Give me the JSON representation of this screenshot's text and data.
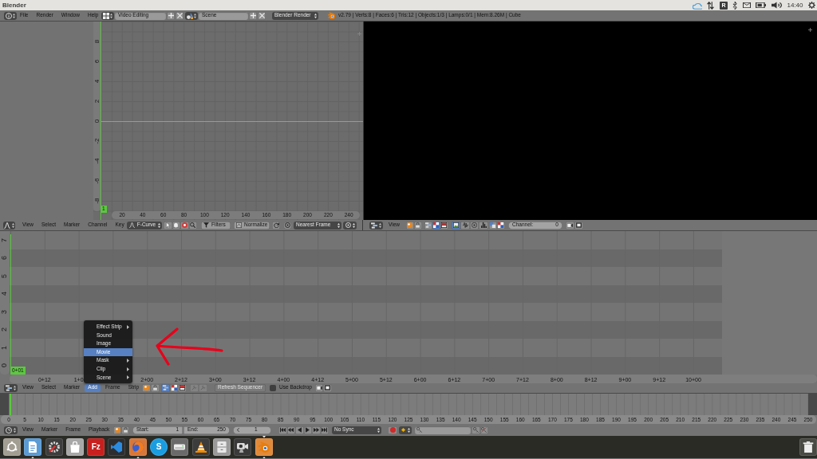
{
  "os_bar": {
    "title": "Blender",
    "tray_badge": "R",
    "clock": "14:40"
  },
  "info_header": {
    "menus": [
      "File",
      "Render",
      "Window",
      "Help"
    ],
    "screen_layout": "Video Editing",
    "scene": "Scene",
    "render_engine": "Blender Render",
    "stats": "v2.79 | Verts:8 | Faces:6 | Tris:12 | Objects:1/3 | Lamps:0/1 | Mem:8.26M | Cube"
  },
  "graph_editor": {
    "current_frame": "1",
    "value_ruler": [
      "8",
      "6",
      "4",
      "2",
      "0",
      "-2",
      "-4",
      "-6",
      "-8"
    ],
    "frame_ruler": [
      "20",
      "40",
      "60",
      "80",
      "100",
      "120",
      "140",
      "160",
      "180",
      "200",
      "220",
      "240"
    ],
    "header": {
      "menus": [
        "View",
        "Select",
        "Marker",
        "Channel",
        "Key"
      ],
      "mode": "F-Curve",
      "toggles": [
        {
          "kind": "pointer",
          "pressed": false
        },
        {
          "kind": "ghost",
          "pressed": false
        },
        {
          "kind": "alert",
          "pressed": false
        },
        {
          "kind": "search",
          "pressed": false
        }
      ],
      "filters": "Filters",
      "normalize": {
        "label": "Normalize",
        "pressed": false
      },
      "auto_snap": "Nearest Frame"
    }
  },
  "preview": {
    "header": {
      "menus": [
        "View"
      ],
      "view_types": [
        {
          "kind": "strips",
          "selected": false
        },
        {
          "kind": "checker",
          "selected": true
        },
        {
          "kind": "split",
          "selected": false
        }
      ],
      "display_modes": [
        {
          "kind": "image",
          "selected": true
        },
        {
          "kind": "wave",
          "selected": false
        },
        {
          "kind": "scope",
          "selected": false
        },
        {
          "kind": "histogram",
          "selected": false
        }
      ],
      "channel_label": "Channel:",
      "channel": "0"
    }
  },
  "sequencer": {
    "channels": [
      "7",
      "6",
      "5",
      "4",
      "3",
      "2",
      "1",
      "0"
    ],
    "current_frame": "0+01",
    "time_ruler": {
      "left": [
        "0+12",
        "1+0"
      ],
      "right": [
        "2+00",
        "2+12",
        "3+00",
        "3+12",
        "4+00",
        "4+12",
        "5+00",
        "5+12",
        "6+00",
        "6+12",
        "7+00",
        "7+12",
        "8+00",
        "8+12",
        "9+00",
        "9+12",
        "10+00"
      ]
    },
    "header": {
      "menus": [
        {
          "label": "View",
          "selected": false
        },
        {
          "label": "Select",
          "selected": false
        },
        {
          "label": "Marker",
          "selected": false
        },
        {
          "label": "Add",
          "selected": true
        },
        {
          "label": "Frame",
          "selected": false
        },
        {
          "label": "Strip",
          "selected": false
        }
      ],
      "view_types": [
        {
          "kind": "strips",
          "selected": true
        },
        {
          "kind": "checker",
          "selected": false
        },
        {
          "kind": "split",
          "selected": false
        }
      ],
      "refresh": {
        "label": "Refresh Sequencer",
        "disabled": true
      },
      "use_backdrop": {
        "label": "Use Backdrop",
        "checked": false
      }
    }
  },
  "add_menu": {
    "items": [
      {
        "label": "Effect Strip",
        "submenu": true,
        "selected": false
      },
      {
        "label": "Sound",
        "submenu": false,
        "selected": false
      },
      {
        "label": "Image",
        "submenu": false,
        "selected": false
      },
      {
        "label": "Movie",
        "submenu": false,
        "selected": true
      },
      {
        "label": "Mask",
        "submenu": true,
        "selected": false
      },
      {
        "label": "Clip",
        "submenu": true,
        "selected": false
      },
      {
        "label": "Scene",
        "submenu": true,
        "selected": false
      }
    ]
  },
  "timeline": {
    "frame_ruler": [
      "0",
      "5",
      "10",
      "15",
      "20",
      "25",
      "30",
      "35",
      "40",
      "45",
      "50",
      "55",
      "60",
      "65",
      "70",
      "75",
      "80",
      "85",
      "90",
      "95",
      "100",
      "105",
      "110",
      "115",
      "120",
      "125",
      "130",
      "135",
      "140",
      "145",
      "150",
      "155",
      "160",
      "165",
      "170",
      "175",
      "180",
      "185",
      "190",
      "195",
      "200",
      "205",
      "210",
      "215",
      "220",
      "225",
      "230",
      "235",
      "240",
      "245",
      "250"
    ],
    "header": {
      "menus": [
        "View",
        "Marker",
        "Frame",
        "Playback"
      ],
      "start_label": "Start:",
      "start": "1",
      "end_label": "End:",
      "end": "250",
      "current": "1",
      "sync": "No Sync"
    }
  },
  "taskbar": {
    "apps": [
      {
        "kind": "dash",
        "running": false,
        "focused": false
      },
      {
        "kind": "document",
        "running": true,
        "focused": false
      },
      {
        "kind": "tools",
        "running": false,
        "focused": false
      },
      {
        "kind": "bag",
        "running": false,
        "focused": false
      },
      {
        "kind": "letters",
        "glyph": "Fz",
        "running": false,
        "focused": false
      },
      {
        "kind": "code",
        "running": false,
        "focused": false
      },
      {
        "kind": "browser",
        "running": true,
        "focused": false
      },
      {
        "kind": "chat",
        "glyph": "S",
        "running": false,
        "focused": false
      },
      {
        "kind": "disk",
        "running": false,
        "focused": false
      },
      {
        "kind": "cone",
        "running": false,
        "focused": false
      },
      {
        "kind": "cabinet",
        "running": false,
        "focused": false
      },
      {
        "kind": "webcam",
        "running": false,
        "focused": false
      },
      {
        "kind": "orbit",
        "running": true,
        "focused": true
      }
    ]
  }
}
